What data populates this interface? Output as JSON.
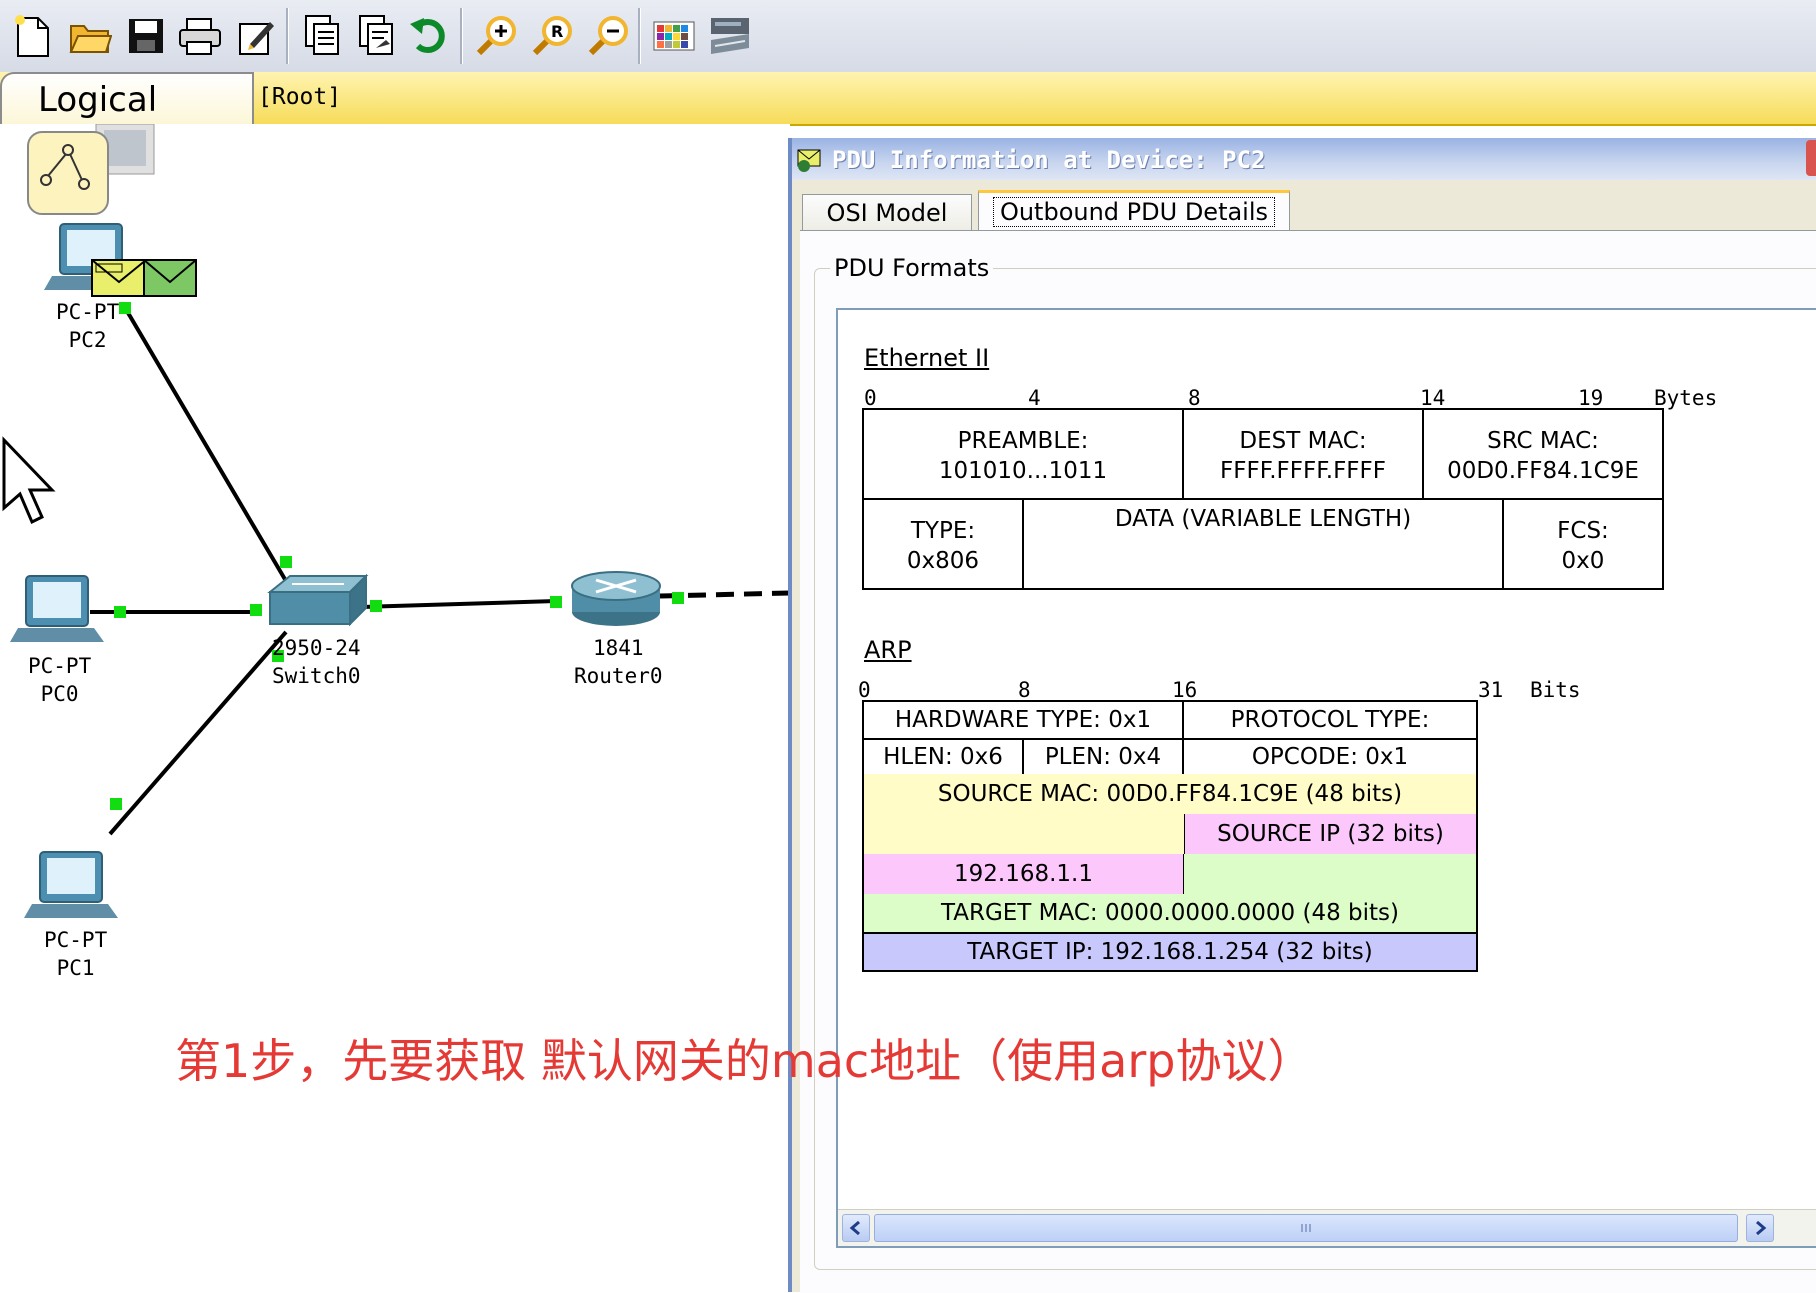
{
  "toolbar": {
    "buttons": [
      "new-icon",
      "open-icon",
      "save-icon",
      "print-icon",
      "activity-wizard-icon",
      "copy-icon",
      "paste-icon",
      "undo-icon",
      "zoom-in-icon",
      "zoom-reset-icon",
      "zoom-out-icon",
      "palette-icon",
      "custom-device-icon"
    ]
  },
  "workspace": {
    "tab_label": "Logical",
    "root_label": "[Root]",
    "devices": {
      "pc2": {
        "type": "PC-PT",
        "name": "PC2"
      },
      "pc0": {
        "type": "PC-PT",
        "name": "PC0"
      },
      "pc1": {
        "type": "PC-PT",
        "name": "PC1"
      },
      "switch0": {
        "type": "2950-24",
        "name": "Switch0"
      },
      "router0": {
        "type": "1841",
        "name": "Router0"
      }
    },
    "annotation": "第1步，先要获取 默认网关的mac地址（使用arp协议）"
  },
  "pdu_window": {
    "title": "PDU Information at Device: PC2",
    "tabs": {
      "osi": "OSI Model",
      "outbound": "Outbound PDU Details"
    },
    "group_label": "PDU Formats",
    "ethernet": {
      "title": "Ethernet II",
      "offsets": [
        "0",
        "4",
        "8",
        "14",
        "19"
      ],
      "unit": "Bytes",
      "preamble": {
        "label": "PREAMBLE:",
        "value": "101010...1011"
      },
      "dest_mac": {
        "label": "DEST MAC:",
        "value": "FFFF.FFFF.FFFF"
      },
      "src_mac": {
        "label": "SRC MAC:",
        "value": "00D0.FF84.1C9E"
      },
      "type": {
        "label": "TYPE:",
        "value": "0x806"
      },
      "data": {
        "label": "DATA (VARIABLE LENGTH)"
      },
      "fcs": {
        "label": "FCS:",
        "value": "0x0"
      }
    },
    "arp": {
      "title": "ARP",
      "offsets": [
        "0",
        "8",
        "16",
        "31"
      ],
      "unit": "Bits",
      "hardware_type": "HARDWARE TYPE: 0x1",
      "protocol_type": "PROTOCOL TYPE:",
      "hlen": "HLEN: 0x6",
      "plen": "PLEN: 0x4",
      "opcode": "OPCODE: 0x1",
      "source_mac": "SOURCE MAC: 00D0.FF84.1C9E (48 bits)",
      "source_ip_label": "SOURCE IP (32 bits)",
      "source_ip_value": "192.168.1.1",
      "target_mac": "TARGET MAC: 0000.0000.0000 (48 bits)",
      "target_ip": "TARGET IP: 192.168.1.254 (32 bits)"
    },
    "colors": {
      "source_mac_fill": "#fffcc8",
      "source_ip_fill": "#fcc8fc",
      "target_mac_fill": "#dcfcc8",
      "target_ip_fill": "#c8c8fc"
    }
  }
}
